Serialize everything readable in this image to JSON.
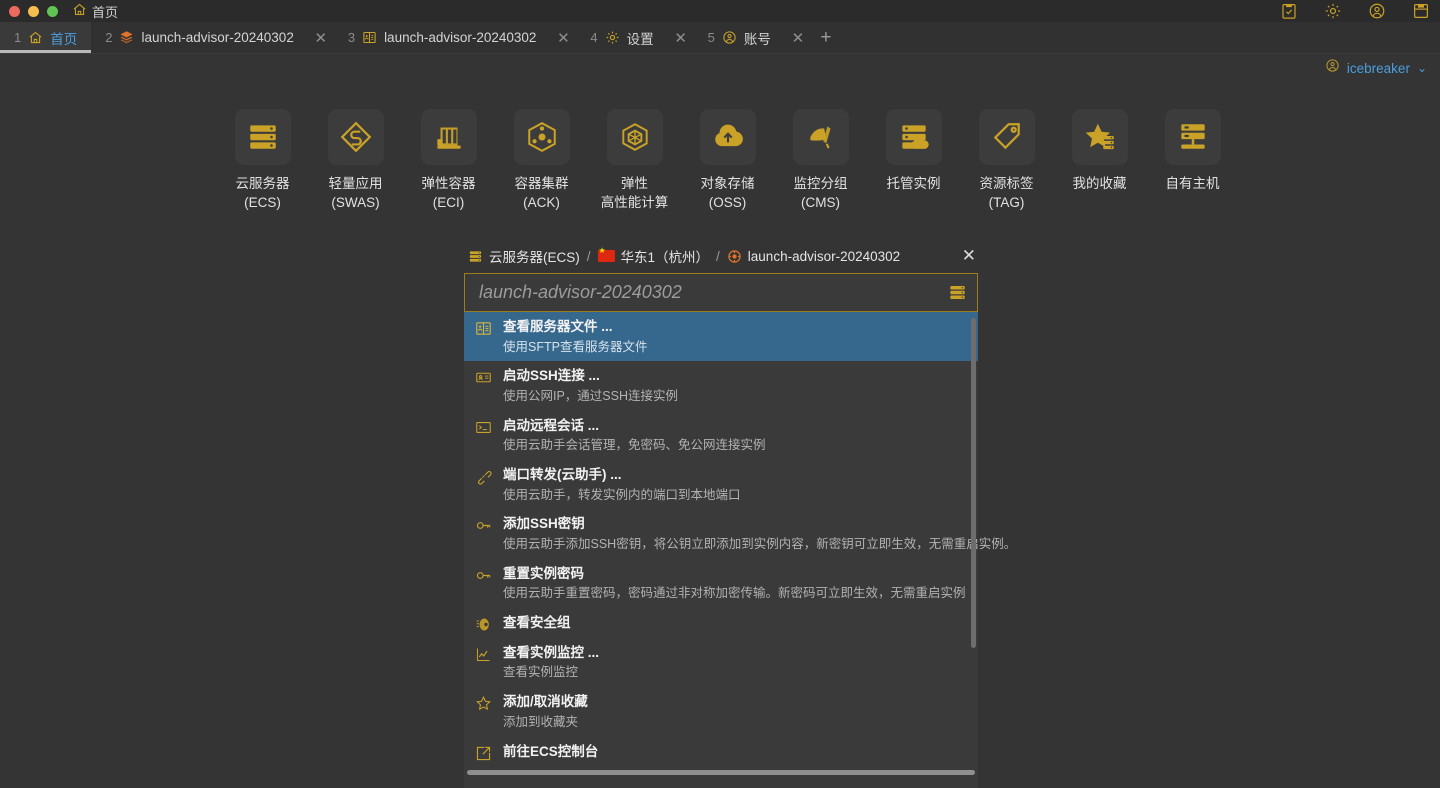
{
  "titlebar": {
    "home_label": "首页",
    "home_icon": "home-icon",
    "right_icons": [
      {
        "name": "clipboard-check-icon"
      },
      {
        "name": "gear-icon"
      },
      {
        "name": "user-circle-icon"
      },
      {
        "name": "window-save-icon"
      }
    ]
  },
  "tabs": [
    {
      "num": "1",
      "label": "首页",
      "icon": "home-icon",
      "active": true,
      "closable": false
    },
    {
      "num": "2",
      "label": "launch-advisor-20240302",
      "icon": "layers-icon",
      "active": false,
      "closable": true
    },
    {
      "num": "3",
      "label": "launch-advisor-20240302",
      "icon": "sftp-folder-icon",
      "active": false,
      "closable": true
    },
    {
      "num": "4",
      "label": "设置",
      "icon": "gear-icon",
      "active": false,
      "closable": true
    },
    {
      "num": "5",
      "label": "账号",
      "icon": "user-circle-icon",
      "active": false,
      "closable": true
    }
  ],
  "tab_add_label": "+",
  "user": {
    "name": "icebreaker",
    "caret": "⌄",
    "icon": "user-circle-icon"
  },
  "products": [
    {
      "icon": "server-icon",
      "label": "云服务器\n(ECS)"
    },
    {
      "icon": "swas-diamond-icon",
      "label": "轻量应用\n(SWAS)"
    },
    {
      "icon": "container-box-icon",
      "label": "弹性容器\n(ECI)"
    },
    {
      "icon": "cube-cluster-icon",
      "label": "容器集群\n(ACK)"
    },
    {
      "icon": "hpc-cube-icon",
      "label": "弹性\n高性能计算"
    },
    {
      "icon": "oss-cloud-icon",
      "label": "对象存储\n(OSS)"
    },
    {
      "icon": "cms-monitor-icon",
      "label": "监控分组\n(CMS)"
    },
    {
      "icon": "managed-host-icon",
      "label": "托管实例"
    },
    {
      "icon": "tag-icon",
      "label": "资源标签\n(TAG)"
    },
    {
      "icon": "star-server-icon",
      "label": "我的收藏"
    },
    {
      "icon": "own-host-icon",
      "label": "自有主机"
    }
  ],
  "popup": {
    "breadcrumb": {
      "product": "云服务器(ECS)",
      "product_icon": "server-icon",
      "separator": "/",
      "region": "华东1（杭州）",
      "region_icon": "cn-flag-icon",
      "instance": "launch-advisor-20240302",
      "instance_icon": "instance-target-icon"
    },
    "close_label": "✕",
    "search": {
      "value": "",
      "placeholder": "launch-advisor-20240302",
      "trailing_icon": "server-icon"
    },
    "items": [
      {
        "icon": "sftp-folder-icon",
        "title": "查看服务器文件 ...",
        "desc": "使用SFTP查看服务器文件",
        "selected": true
      },
      {
        "icon": "ssh-key-card-icon",
        "title": "启动SSH连接 ...",
        "desc": "使用公网IP，通过SSH连接实例",
        "selected": false
      },
      {
        "icon": "terminal-icon",
        "title": "启动远程会话 ...",
        "desc": "使用云助手会话管理，免密码、免公网连接实例",
        "selected": false
      },
      {
        "icon": "port-forward-icon",
        "title": "端口转发(云助手) ...",
        "desc": "使用云助手，转发实例内的端口到本地端口",
        "selected": false
      },
      {
        "icon": "key-icon",
        "title": "添加SSH密钥",
        "desc": "使用云助手添加SSH密钥，将公钥立即添加到实例内容，新密钥可立即生效，无需重启实例。",
        "selected": false
      },
      {
        "icon": "key-icon",
        "title": "重置实例密码",
        "desc": "使用云助手重置密码，密码通过非对称加密传输。新密码可立即生效，无需重启实例",
        "selected": false
      },
      {
        "icon": "security-group-icon",
        "title": "查看安全组",
        "desc": "",
        "selected": false
      },
      {
        "icon": "chart-line-icon",
        "title": "查看实例监控 ...",
        "desc": "查看实例监控",
        "selected": false
      },
      {
        "icon": "star-outline-icon",
        "title": "添加/取消收藏",
        "desc": "添加到收藏夹",
        "selected": false
      },
      {
        "icon": "external-link-icon",
        "title": "前往ECS控制台",
        "desc": "",
        "selected": false
      }
    ]
  },
  "colors": {
    "background": "#343434",
    "titlebar": "#2b2b2b",
    "tabbar": "#313131",
    "panel": "#3a3a3a",
    "accent_gold": "#c9a227",
    "accent_blue": "#4b9fe0",
    "selection_blue": "#36688e"
  }
}
